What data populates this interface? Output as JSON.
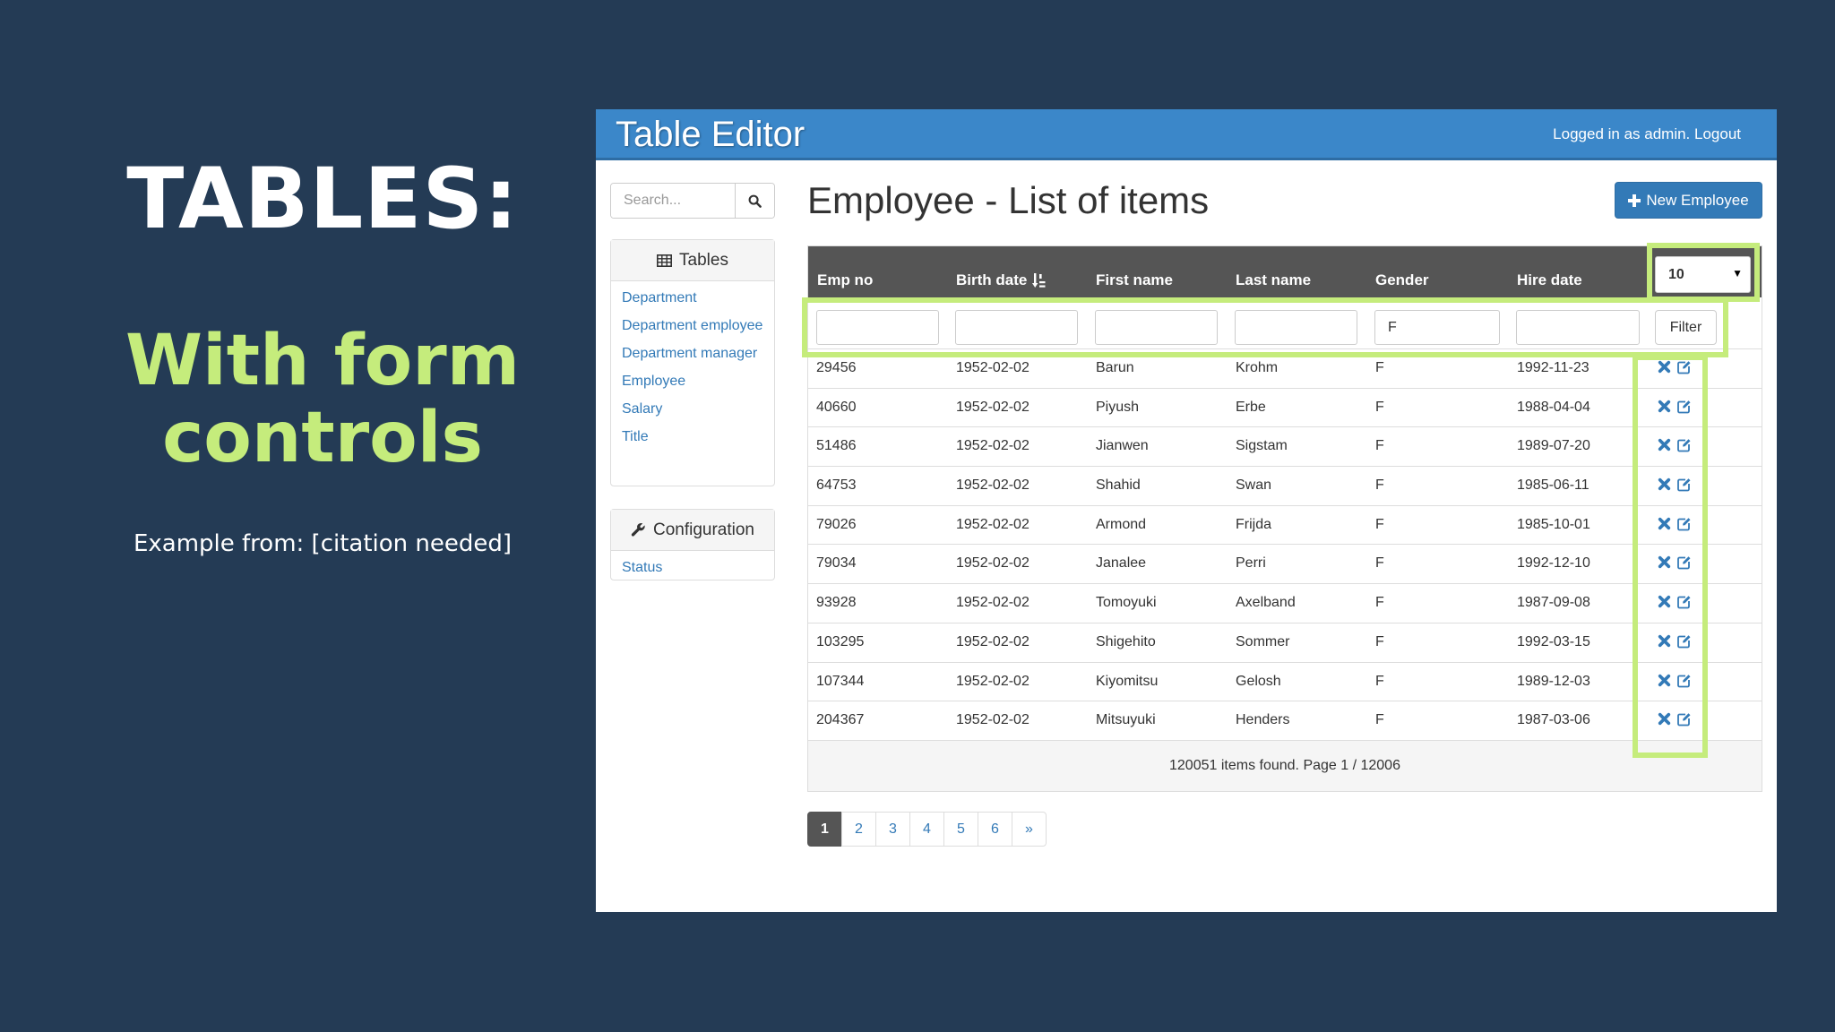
{
  "slide": {
    "title": "TABLES:",
    "subtitle_line1": "With form",
    "subtitle_line2": "controls",
    "source": "Example from: [citation needed]"
  },
  "app": {
    "brand": "Table Editor",
    "login_text": "Logged in as admin. Logout",
    "search": {
      "placeholder": "Search..."
    },
    "sidebar": {
      "tables_heading": "Tables",
      "tables": [
        "Department",
        "Department employee",
        "Department manager",
        "Employee",
        "Salary",
        "Title"
      ],
      "config_heading": "Configuration",
      "config_items": [
        "Status"
      ]
    },
    "page_title": "Employee - List of items",
    "new_button": "New Employee",
    "table": {
      "columns": [
        "Emp no",
        "Birth date",
        "First name",
        "Last name",
        "Gender",
        "Hire date"
      ],
      "page_size": "10",
      "filter_button": "Filter",
      "filters": {
        "gender": "F"
      },
      "rows": [
        [
          "29456",
          "1952-02-02",
          "Barun",
          "Krohm",
          "F",
          "1992-11-23"
        ],
        [
          "40660",
          "1952-02-02",
          "Piyush",
          "Erbe",
          "F",
          "1988-04-04"
        ],
        [
          "51486",
          "1952-02-02",
          "Jianwen",
          "Sigstam",
          "F",
          "1989-07-20"
        ],
        [
          "64753",
          "1952-02-02",
          "Shahid",
          "Swan",
          "F",
          "1985-06-11"
        ],
        [
          "79026",
          "1952-02-02",
          "Armond",
          "Frijda",
          "F",
          "1985-10-01"
        ],
        [
          "79034",
          "1952-02-02",
          "Janalee",
          "Perri",
          "F",
          "1992-12-10"
        ],
        [
          "93928",
          "1952-02-02",
          "Tomoyuki",
          "Axelband",
          "F",
          "1987-09-08"
        ],
        [
          "103295",
          "1952-02-02",
          "Shigehito",
          "Sommer",
          "F",
          "1992-03-15"
        ],
        [
          "107344",
          "1952-02-02",
          "Kiyomitsu",
          "Gelosh",
          "F",
          "1989-12-03"
        ],
        [
          "204367",
          "1952-02-02",
          "Mitsuyuki",
          "Henders",
          "F",
          "1987-03-06"
        ]
      ],
      "summary": "120051 items found. Page 1 / 12006"
    },
    "pagination": [
      "1",
      "2",
      "3",
      "4",
      "5",
      "6",
      "»"
    ],
    "active_page": "1"
  },
  "colors": {
    "background": "#243b55",
    "highlight": "#c5ec7c",
    "navbar": "#3b87c9",
    "table_header": "#555555",
    "link": "#337ab7"
  }
}
